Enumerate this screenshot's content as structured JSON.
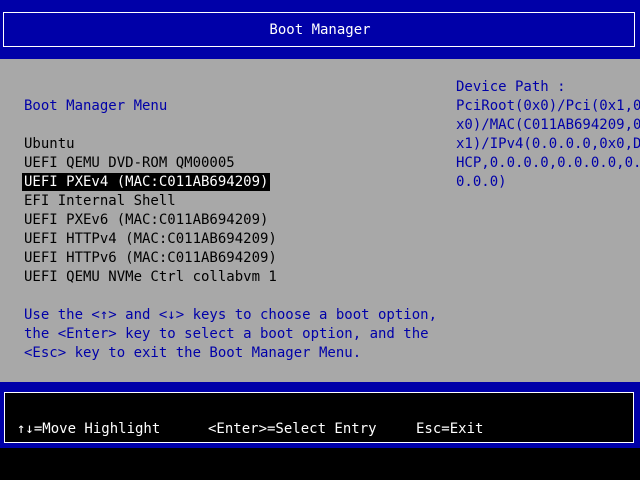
{
  "colors": {
    "band_blue": "#0000a8",
    "panel_gray": "#a8a8a8",
    "text_blue": "#0000a8",
    "selection_bg": "#000000",
    "selection_fg": "#ffffff"
  },
  "header": {
    "title": "Boot Manager"
  },
  "menu": {
    "title": "Boot Manager Menu",
    "selected_index": 2,
    "entries": [
      {
        "label": "Ubuntu"
      },
      {
        "label": "UEFI QEMU DVD-ROM QM00005"
      },
      {
        "label": "UEFI PXEv4 (MAC:C011AB694209)"
      },
      {
        "label": "EFI Internal Shell"
      },
      {
        "label": "UEFI PXEv6 (MAC:C011AB694209)"
      },
      {
        "label": "UEFI HTTPv4 (MAC:C011AB694209)"
      },
      {
        "label": "UEFI HTTPv6 (MAC:C011AB694209)"
      },
      {
        "label": "UEFI QEMU NVMe Ctrl collabvm 1"
      }
    ]
  },
  "help": {
    "lines": [
      "Use the <↑> and <↓> keys to choose a boot option,",
      "the <Enter> key to select a boot option, and the",
      "<Esc> key to exit the Boot Manager Menu."
    ]
  },
  "device_path": {
    "label": "Device Path :",
    "lines": [
      "PciRoot(0x0)/Pci(0x1,0",
      "x0)/MAC(C011AB694209,0",
      "x1)/IPv4(0.0.0.0,0x0,D",
      "HCP,0.0.0.0,0.0.0.0,0.",
      "0.0.0)"
    ]
  },
  "footer": {
    "move": "↑↓=Move Highlight",
    "select": "<Enter>=Select Entry",
    "exit": "Esc=Exit"
  }
}
